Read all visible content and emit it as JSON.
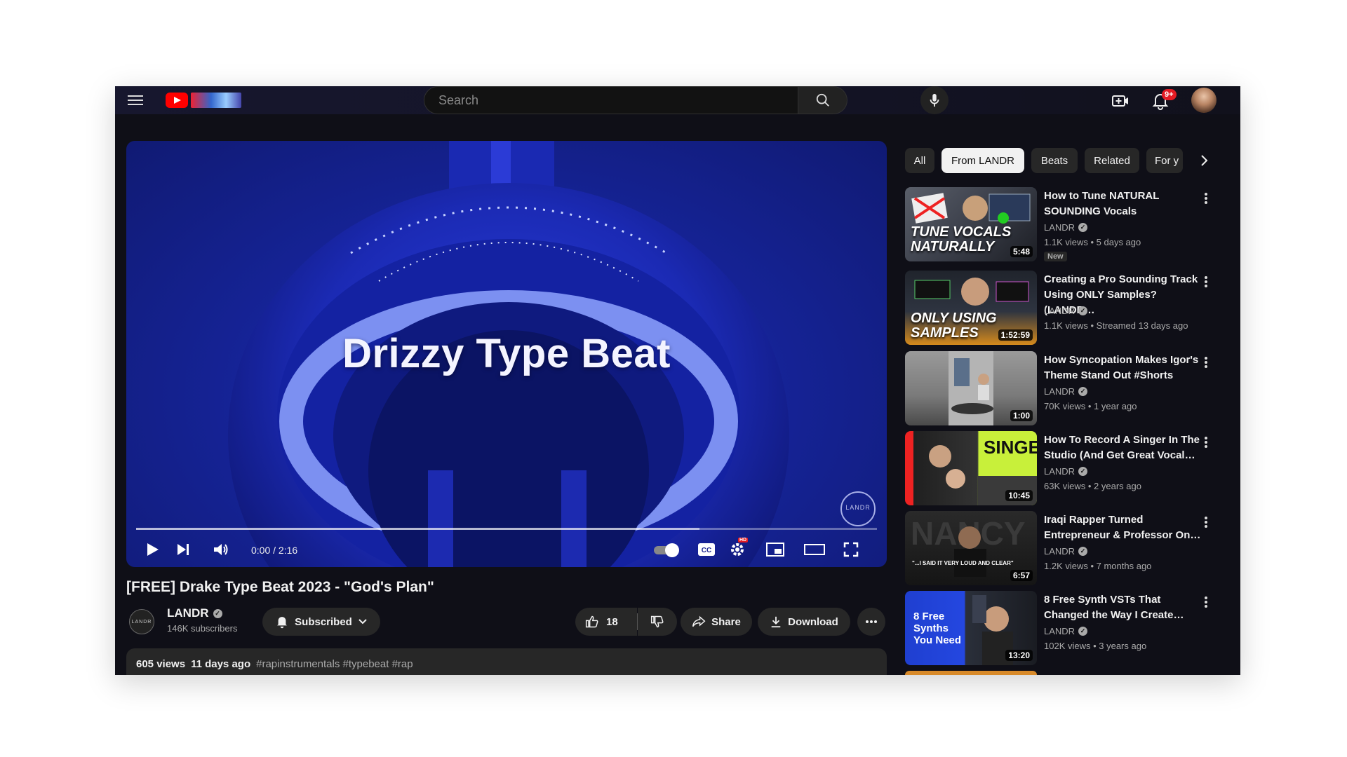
{
  "header": {
    "search_placeholder": "Search",
    "notifications_badge": "9+"
  },
  "video": {
    "overlay_title": "Drizzy Type Beat",
    "watermark": "LANDR",
    "time": "0:00 / 2:16",
    "buffered": 0.76,
    "title": "[FREE] Drake Type Beat 2023 - \"God's Plan\"",
    "hd_badge": "HD"
  },
  "channel": {
    "avatar_text": "LANDR",
    "name": "LANDR",
    "verified_mark": "✓",
    "subscribers": "146K subscribers"
  },
  "actions": {
    "subscribed_label": "Subscribed",
    "like_count": "18",
    "share_label": "Share",
    "download_label": "Download"
  },
  "description": {
    "views": "605 views",
    "date": "11 days ago",
    "tags": "#rapinstrumentals #typebeat #rap"
  },
  "chips": [
    "All",
    "From LANDR",
    "Beats",
    "Related",
    "For y"
  ],
  "recommendations": [
    {
      "title": "How to Tune NATURAL SOUNDING Vocals",
      "channel": "LANDR",
      "meta": "1.1K views  • 5 days ago",
      "duration": "5:48",
      "badge": "New",
      "thumb_text": "TUNE VOCALS NATURALLY"
    },
    {
      "title": "Creating a Pro Sounding Track Using ONLY Samples? (LANDR…",
      "channel": "LANDR",
      "meta": "1.1K views  • Streamed 13 days ago",
      "duration": "1:52:59",
      "thumb_text": "ONLY USING SAMPLES"
    },
    {
      "title": "How Syncopation Makes Igor's Theme Stand Out #Shorts",
      "channel": "LANDR",
      "meta": "70K views  • 1 year ago",
      "duration": "1:00",
      "thumb_text": ""
    },
    {
      "title": "How To Record A Singer In The Studio (And Get Great Vocal…",
      "channel": "LANDR",
      "meta": "63K views  • 2 years ago",
      "duration": "10:45",
      "thumb_text": "SINGER"
    },
    {
      "title": "Iraqi Rapper Turned Entrepreneur & Professor On…",
      "channel": "LANDR",
      "meta": "1.2K views  • 7 months ago",
      "duration": "6:57",
      "thumb_text": "\"...I SAID IT VERY LOUD AND CLEAR\""
    },
    {
      "title": "8 Free Synth VSTs That Changed the Way I Create…",
      "channel": "LANDR",
      "meta": "102K views  • 3 years ago",
      "duration": "13:20",
      "thumb_text": "8 Free Synths You Need"
    }
  ],
  "colors": {
    "accent_red": "#ff0000",
    "badge_red": "#e41b23",
    "player_blue": "#1c2fc4",
    "singer_thumb_green": "#c8f03a"
  }
}
